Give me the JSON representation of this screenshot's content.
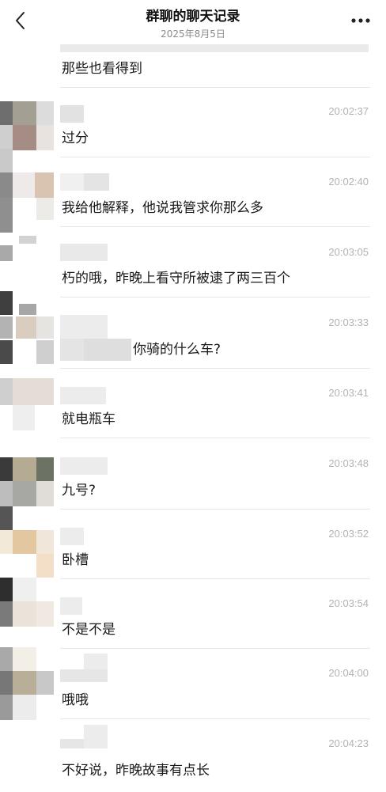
{
  "header": {
    "title": "群聊的聊天记录",
    "date": "2025年8月5日"
  },
  "colors": {
    "background": "#ffffff",
    "text": "#1a1a1a",
    "timestamp": "#b3b3b3",
    "subtitle": "#8a8a8a",
    "divider": "#e6e6e6"
  },
  "icons": {
    "back": "chevron-left",
    "more": "ellipsis-horizontal"
  },
  "messages": [
    {
      "time": "",
      "text": "那些也看得到"
    },
    {
      "time": "20:02:37",
      "text": "过分"
    },
    {
      "time": "20:02:40",
      "text": "我给他解释，他说我管求你那么多"
    },
    {
      "time": "20:03:05",
      "text": "朽的哦，昨晚上看守所被逮了两三百个"
    },
    {
      "time": "20:03:33",
      "text": "你骑的什么车?"
    },
    {
      "time": "20:03:41",
      "text": "就电瓶车"
    },
    {
      "time": "20:03:48",
      "text": "九号?"
    },
    {
      "time": "20:03:52",
      "text": "卧槽"
    },
    {
      "time": "20:03:54",
      "text": "不是不是"
    },
    {
      "time": "20:04:00",
      "text": "哦哦"
    },
    {
      "time": "20:04:23",
      "text": "不好说，昨晚故事有点长"
    }
  ]
}
